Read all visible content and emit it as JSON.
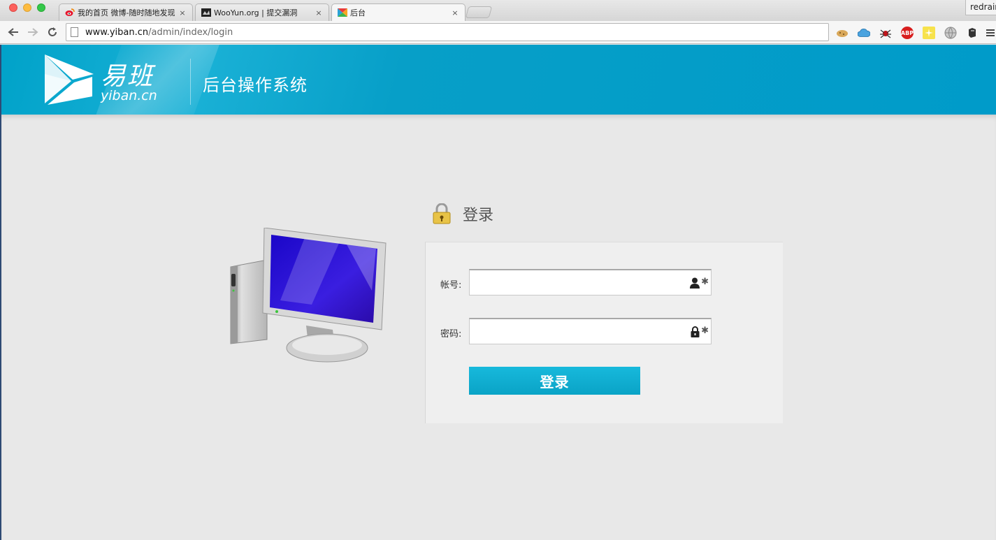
{
  "browser": {
    "tabs": [
      {
        "title": "我的首页 微博-随时随地发现",
        "icon": "weibo-icon"
      },
      {
        "title": "WooYun.org | 提交漏洞",
        "icon": "wooyun-icon"
      },
      {
        "title": "后台",
        "icon": "yiban-icon"
      }
    ],
    "close_glyph": "×",
    "profile_name": "redrain",
    "url_host": "www.yiban.cn",
    "url_path": "/admin/index/login",
    "extensions": [
      "cookie-icon",
      "cloud-icon",
      "spider-icon",
      "adblock-icon",
      "sticky-icon",
      "globe-icon",
      "evernote-icon"
    ],
    "adblock_label": "ABP"
  },
  "header": {
    "logo_cn": "易班",
    "logo_en": "yiban.cn",
    "system_title": "后台操作系统"
  },
  "login": {
    "heading": "登录",
    "username_label": "帐号:",
    "password_label": "密码:",
    "required_mark": "✱",
    "submit_label": "登录"
  },
  "colors": {
    "banner": "#00a2c9",
    "button": "#0aa3c6"
  }
}
